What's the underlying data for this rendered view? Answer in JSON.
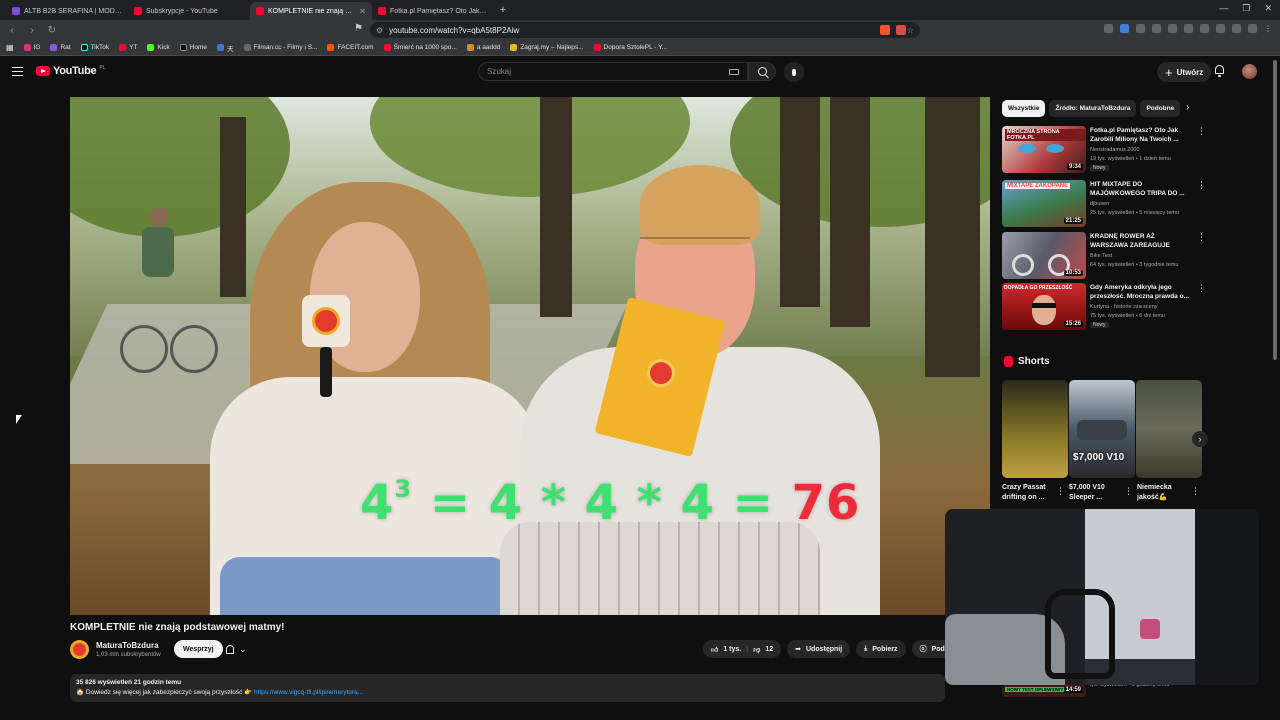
{
  "browser": {
    "tabs": [
      {
        "title": "ALTB B2B SERAFINA | MODUŁ AF",
        "active": false
      },
      {
        "title": "Subskrypcje - YouTube",
        "active": false
      },
      {
        "title": "KOMPLETNIE nie znają podsta",
        "active": true
      },
      {
        "title": "Fotka.pl Pamiętasz? Oto Jak Zarobił",
        "active": false
      }
    ],
    "url": "youtube.com/watch?v=qbA5t8P2Aiw",
    "bookmarks": [
      "IG",
      "Rat",
      "TikTok",
      "YT",
      "Kick",
      "Home",
      "天",
      "Filman.cc - Filmy i S...",
      "FACEIT.com",
      "Śmierć na 1000 spo...",
      "a aaddd",
      "Zagraj.my – Najleps...",
      "Dopora SztolePL - Y..."
    ]
  },
  "masthead": {
    "logo_text": "YouTube",
    "country_code": "PL",
    "search_placeholder": "Szukaj",
    "create_label": "Utwórz"
  },
  "video": {
    "formula": {
      "base": "4",
      "exp": "3",
      "rest_green": " = 4 * 4 * 4 = ",
      "result": "76"
    },
    "title": "KOMPLETNIE nie znają podstawowej matmy!",
    "channel": "MaturaToBzdura",
    "subscribers": "1,03 mln subskrybentów",
    "support_label": "Wesprzyj",
    "likes": "1 tys.",
    "dislikes": "12",
    "share_label": "Udostępnij",
    "download_label": "Pobierz",
    "extra_label": "Podz",
    "views_line": "35 826 wyświetleń  21 godzin temu",
    "desc_line": "🏠 Dowiedz się więcej jak zabezpieczyć swoją przyszłość 👉",
    "desc_link": "https://www.vigcq-tfi.pl/ipi/emerytura..."
  },
  "sidebar": {
    "chips": [
      "Wszystkie",
      "Źródło: MaturaToBzdura",
      "Podobne"
    ],
    "recommendations": [
      {
        "title": "Fotka.pl Pamiętasz? Oto Jak Zarobili Miliony Na Twoich ...",
        "channel": "Neostradamus 2000",
        "meta": "19 tys. wyświetleń • 1 dzień temu",
        "badge": "Nowy",
        "duration": "9:34",
        "thumb_text": "MROCZNA STRONA FOTKA.PL",
        "thumb_color": "#b03a3a"
      },
      {
        "title": "HIT MIXTAPE DO MAJÓWKOWEGO TRIPA DO ...",
        "channel": "djbusen",
        "meta": "25 tys. wyświetleń • 5 miesięcy temu",
        "badge": "",
        "duration": "21:25",
        "thumb_text": "MIXTAPE ZAKOPANE",
        "thumb_color": "#3a7a4a"
      },
      {
        "title": "KRADNĘ ROWER AŻ WARSZAWA ZAREAGUJE",
        "channel": "Bike Test",
        "meta": "64 tys. wyświetleń • 3 tygodnie temu",
        "badge": "",
        "duration": "10:53",
        "thumb_text": "",
        "thumb_color": "#5a5a6a"
      },
      {
        "title": "Gdy Ameryka odkryła jego przeszłość. Mroczna prawda o...",
        "channel": "Kurtyna - historie zza sceny",
        "meta": "75 tys. wyświetleń • 6 dni temu",
        "badge": "Nowy",
        "duration": "15:26",
        "thumb_text": "DOPADŁA GO PRZESZŁOŚĆ",
        "thumb_color": "#9a1a1a"
      }
    ],
    "shorts_header": "Shorts",
    "shorts": [
      {
        "title": "Crazy Passat drifting on ...",
        "price": "",
        "color": "#6a5a1a"
      },
      {
        "title": "$7,000 V10 Sleeper ...",
        "price": "$7,000 V10",
        "color": "#4a5a6a"
      },
      {
        "title": "Niemiecka jakość💪",
        "price": "",
        "color": "#5a5a4a"
      }
    ],
    "bottom_rec": {
      "label": "NOWY TEST OPLEWIOWY",
      "duration": "14:59",
      "meta": "tys. wyświetleń • 1 godzinę temu"
    }
  }
}
